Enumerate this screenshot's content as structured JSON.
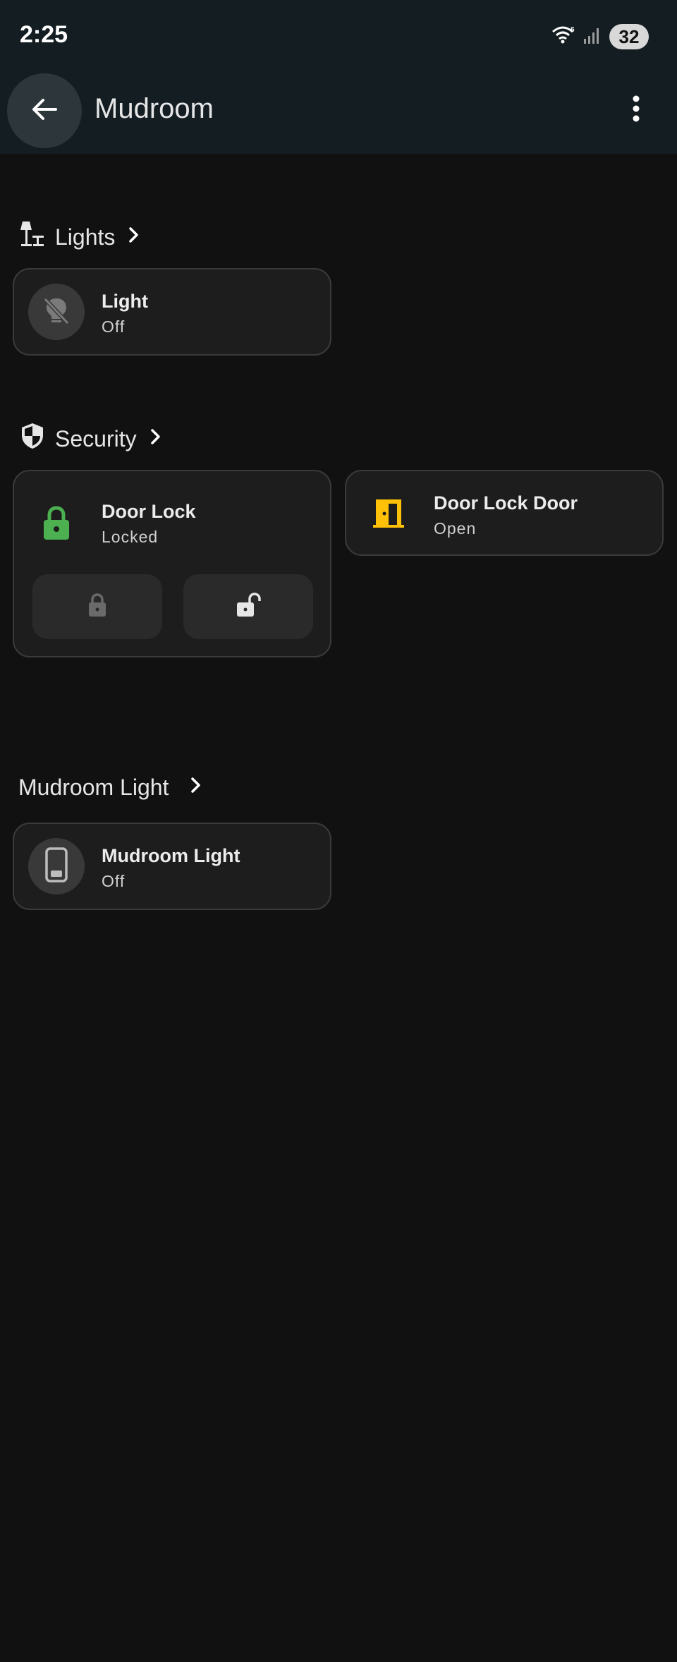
{
  "status_bar": {
    "time": "2:25",
    "battery": "32"
  },
  "header": {
    "title": "Mudroom"
  },
  "sections": {
    "lights": {
      "title": "Lights",
      "card": {
        "name": "Light",
        "state": "Off"
      }
    },
    "security": {
      "title": "Security",
      "door_lock": {
        "name": "Door Lock",
        "state": "Locked"
      },
      "door_lock_door": {
        "name": "Door Lock Door",
        "state": "Open"
      }
    },
    "mudroom_light": {
      "title": "Mudroom Light",
      "card": {
        "name": "Mudroom Light",
        "state": "Off"
      }
    }
  },
  "colors": {
    "lock_green": "#4caf50",
    "door_amber": "#ffc107",
    "header_bg": "#131d22",
    "page_bg": "#111111"
  },
  "icons": {
    "back": "arrow-left-icon",
    "menu": "more-vertical-icon",
    "lights_section": "floor-lamp-icon",
    "security_section": "shield-icon",
    "light_off": "lightbulb-off-icon",
    "lock": "lock-icon",
    "unlock": "lock-open-icon",
    "door": "door-open-icon",
    "switch": "light-switch-icon"
  }
}
